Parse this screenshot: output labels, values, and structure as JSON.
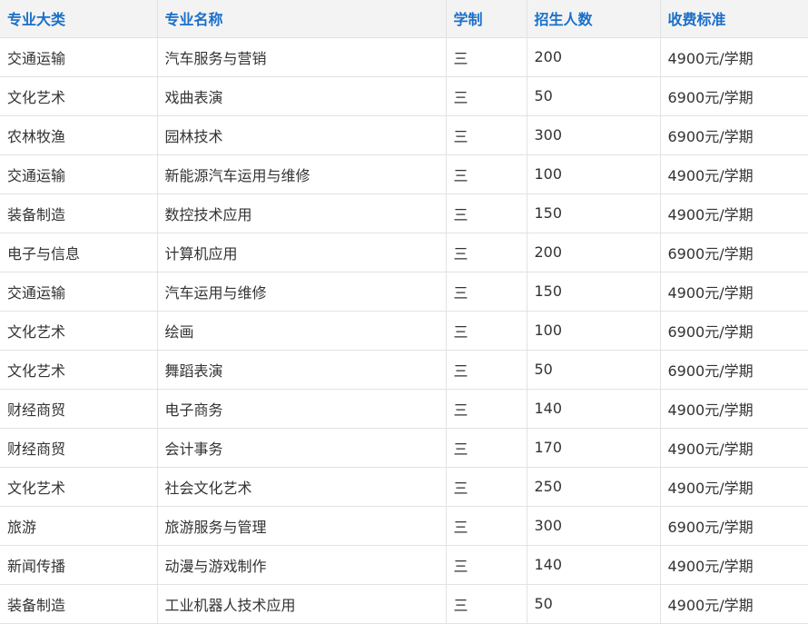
{
  "headers": [
    "专业大类",
    "专业名称",
    "学制",
    "招生人数",
    "收费标准"
  ],
  "rows": [
    [
      "交通运输",
      "汽车服务与营销",
      "三",
      "200",
      "4900元/学期"
    ],
    [
      "文化艺术",
      "戏曲表演",
      "三",
      "50",
      "6900元/学期"
    ],
    [
      "农林牧渔",
      "园林技术",
      "三",
      "300",
      "6900元/学期"
    ],
    [
      "交通运输",
      "新能源汽车运用与维修",
      "三",
      "100",
      "4900元/学期"
    ],
    [
      "装备制造",
      "数控技术应用",
      "三",
      "150",
      "4900元/学期"
    ],
    [
      "电子与信息",
      "计算机应用",
      "三",
      "200",
      "6900元/学期"
    ],
    [
      "交通运输",
      "汽车运用与维修",
      "三",
      "150",
      "4900元/学期"
    ],
    [
      "文化艺术",
      "绘画",
      "三",
      "100",
      "6900元/学期"
    ],
    [
      "文化艺术",
      "舞蹈表演",
      "三",
      "50",
      "6900元/学期"
    ],
    [
      "财经商贸",
      "电子商务",
      "三",
      "140",
      "4900元/学期"
    ],
    [
      "财经商贸",
      "会计事务",
      "三",
      "170",
      "4900元/学期"
    ],
    [
      "文化艺术",
      "社会文化艺术",
      "三",
      "250",
      "4900元/学期"
    ],
    [
      "旅游",
      "旅游服务与管理",
      "三",
      "300",
      "6900元/学期"
    ],
    [
      "新闻传播",
      "动漫与游戏制作",
      "三",
      "140",
      "4900元/学期"
    ],
    [
      "装备制造",
      "工业机器人技术应用",
      "三",
      "50",
      "4900元/学期"
    ]
  ],
  "colors": {
    "header_text": "#1a6fc9",
    "header_bg": "#f3f3f3",
    "border": "#e2e2e2",
    "body_text": "#333333"
  }
}
